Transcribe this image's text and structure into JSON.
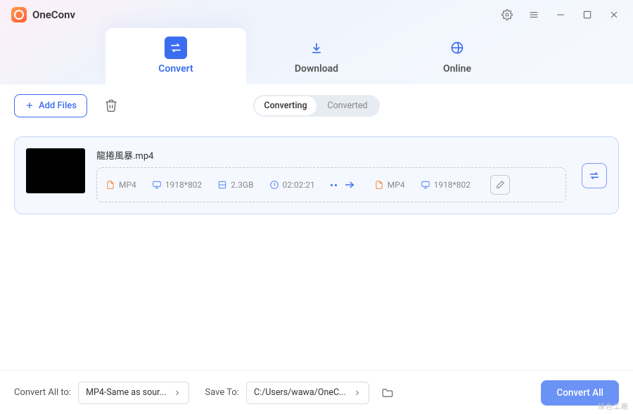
{
  "app": {
    "title": "OneConv"
  },
  "tabs": {
    "convert": "Convert",
    "download": "Download",
    "online": "Online",
    "active": "convert"
  },
  "toolbar": {
    "add_files": "Add Files",
    "segment": {
      "converting": "Converting",
      "converted": "Converted",
      "active": "converting"
    }
  },
  "file": {
    "name": "龍捲風暴.mp4",
    "source": {
      "format": "MP4",
      "resolution": "1918*802",
      "size": "2.3GB",
      "duration": "02:02:21"
    },
    "target": {
      "format": "MP4",
      "resolution": "1918*802"
    }
  },
  "bottom": {
    "convert_all_to_label": "Convert All to:",
    "convert_all_to_value": "MP4-Same as sour...",
    "save_to_label": "Save To:",
    "save_to_value": "C:/Users/wawa/OneC...",
    "convert_all_button": "Convert All"
  },
  "watermark": "綠色工廠"
}
